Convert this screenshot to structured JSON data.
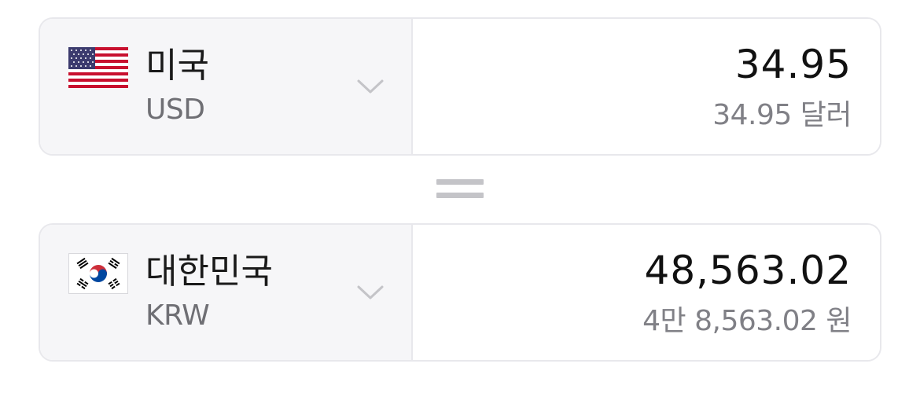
{
  "converter": {
    "from": {
      "flag_icon": "us-flag-icon",
      "country": "미국",
      "code": "USD",
      "amount": "34.95",
      "amount_readout": "34.95 달러"
    },
    "operator": "equals-icon",
    "to": {
      "flag_icon": "kr-flag-icon",
      "country": "대한민국",
      "code": "KRW",
      "amount": "48,563.02",
      "amount_readout": "4만 8,563.02 원"
    }
  },
  "colors": {
    "border": "#e8e8ec",
    "select_background": "#f6f6f8",
    "primary_text": "#111111",
    "secondary_text": "#808086",
    "equals": "#c4c4c8"
  }
}
